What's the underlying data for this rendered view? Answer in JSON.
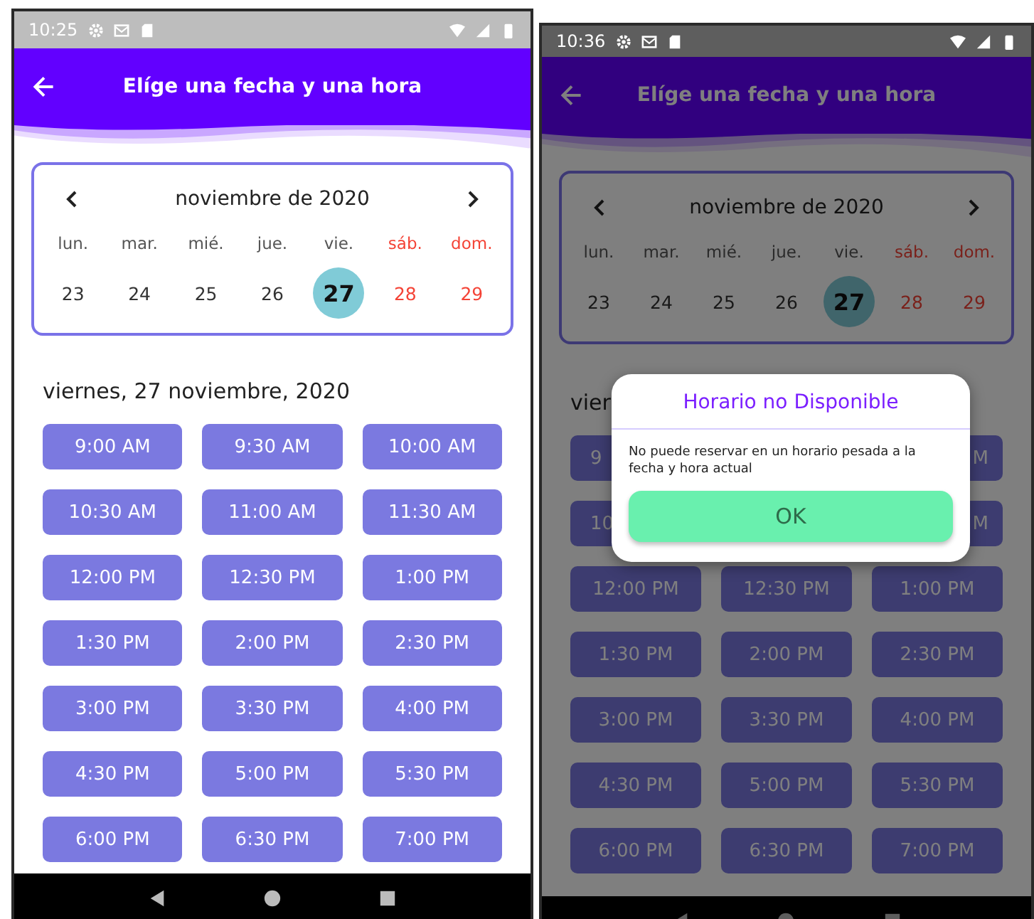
{
  "screens": [
    {
      "status_bar": {
        "time": "10:25"
      },
      "app_bar": {
        "title": "Elíge una fecha y una hora"
      },
      "calendar": {
        "month": "noviembre de 2020",
        "weekdays": [
          {
            "label": "lun.",
            "weekend": false
          },
          {
            "label": "mar.",
            "weekend": false
          },
          {
            "label": "mié.",
            "weekend": false
          },
          {
            "label": "jue.",
            "weekend": false
          },
          {
            "label": "vie.",
            "weekend": false
          },
          {
            "label": "sáb.",
            "weekend": true
          },
          {
            "label": "dom.",
            "weekend": true
          }
        ],
        "days": [
          {
            "label": "23",
            "weekend": false,
            "selected": false
          },
          {
            "label": "24",
            "weekend": false,
            "selected": false
          },
          {
            "label": "25",
            "weekend": false,
            "selected": false
          },
          {
            "label": "26",
            "weekend": false,
            "selected": false
          },
          {
            "label": "27",
            "weekend": false,
            "selected": true
          },
          {
            "label": "28",
            "weekend": true,
            "selected": false
          },
          {
            "label": "29",
            "weekend": true,
            "selected": false
          }
        ]
      },
      "date_heading": "viernes, 27 noviembre, 2020",
      "slots": [
        {
          "kind": "full",
          "label": "9:00 AM"
        },
        {
          "kind": "full",
          "label": "9:30 AM"
        },
        {
          "kind": "full",
          "label": "10:00 AM"
        },
        {
          "kind": "full",
          "label": "10:30 AM"
        },
        {
          "kind": "full",
          "label": "11:00 AM"
        },
        {
          "kind": "full",
          "label": "11:30 AM"
        },
        {
          "kind": "full",
          "label": "12:00 PM"
        },
        {
          "kind": "full",
          "label": "12:30 PM"
        },
        {
          "kind": "full",
          "label": "1:00 PM"
        },
        {
          "kind": "full",
          "label": "1:30 PM"
        },
        {
          "kind": "full",
          "label": "2:00 PM"
        },
        {
          "kind": "full",
          "label": "2:30 PM"
        },
        {
          "kind": "full",
          "label": "3:00 PM"
        },
        {
          "kind": "full",
          "label": "3:30 PM"
        },
        {
          "kind": "full",
          "label": "4:00 PM"
        },
        {
          "kind": "full",
          "label": "4:30 PM"
        },
        {
          "kind": "full",
          "label": "5:00 PM"
        },
        {
          "kind": "full",
          "label": "5:30 PM"
        },
        {
          "kind": "full",
          "label": "6:00 PM"
        },
        {
          "kind": "full",
          "label": "6:30 PM"
        },
        {
          "kind": "full",
          "label": "7:00 PM"
        }
      ]
    },
    {
      "status_bar": {
        "time": "10:36"
      },
      "app_bar": {
        "title": "Elíge una fecha y una hora"
      },
      "calendar": {
        "month": "noviembre de 2020",
        "weekdays": [
          {
            "label": "lun.",
            "weekend": false
          },
          {
            "label": "mar.",
            "weekend": false
          },
          {
            "label": "mié.",
            "weekend": false
          },
          {
            "label": "jue.",
            "weekend": false
          },
          {
            "label": "vie.",
            "weekend": false
          },
          {
            "label": "sáb.",
            "weekend": true
          },
          {
            "label": "dom.",
            "weekend": true
          }
        ],
        "days": [
          {
            "label": "23",
            "weekend": false,
            "selected": false
          },
          {
            "label": "24",
            "weekend": false,
            "selected": false
          },
          {
            "label": "25",
            "weekend": false,
            "selected": false
          },
          {
            "label": "26",
            "weekend": false,
            "selected": false
          },
          {
            "label": "27",
            "weekend": false,
            "selected": true
          },
          {
            "label": "28",
            "weekend": true,
            "selected": false
          },
          {
            "label": "29",
            "weekend": true,
            "selected": false
          }
        ]
      },
      "date_heading": "vier",
      "slots": [
        {
          "kind": "cut_left",
          "label": "9"
        },
        {
          "kind": "hidden"
        },
        {
          "kind": "cut_right",
          "label": "M"
        },
        {
          "kind": "cut_left",
          "label": "10"
        },
        {
          "kind": "hidden"
        },
        {
          "kind": "cut_right",
          "label": "M"
        },
        {
          "kind": "full",
          "label": "12:00 PM"
        },
        {
          "kind": "full",
          "label": "12:30 PM"
        },
        {
          "kind": "full",
          "label": "1:00 PM"
        },
        {
          "kind": "full",
          "label": "1:30 PM"
        },
        {
          "kind": "full",
          "label": "2:00 PM"
        },
        {
          "kind": "full",
          "label": "2:30 PM"
        },
        {
          "kind": "full",
          "label": "3:00 PM"
        },
        {
          "kind": "full",
          "label": "3:30 PM"
        },
        {
          "kind": "full",
          "label": "4:00 PM"
        },
        {
          "kind": "full",
          "label": "4:30 PM"
        },
        {
          "kind": "full",
          "label": "5:00 PM"
        },
        {
          "kind": "full",
          "label": "5:30 PM"
        },
        {
          "kind": "full",
          "label": "6:00 PM"
        },
        {
          "kind": "full",
          "label": "6:30 PM"
        },
        {
          "kind": "full",
          "label": "7:00 PM"
        }
      ],
      "dialog": {
        "title": "Horario no Disponible",
        "message": "No puede reservar en un horario pesada a la fecha  y hora actual",
        "button": "OK"
      }
    }
  ]
}
